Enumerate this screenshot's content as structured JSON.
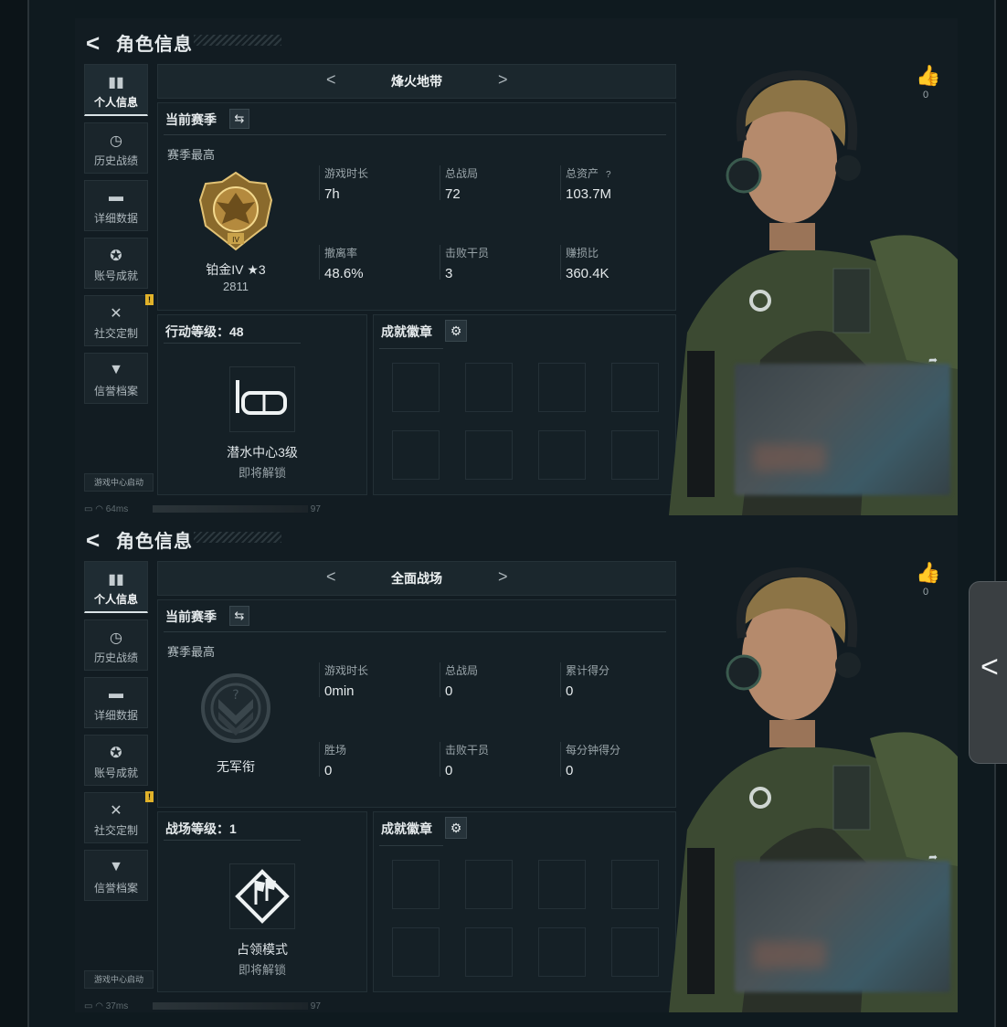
{
  "screens": [
    {
      "header": {
        "back": "<",
        "title": "角色信息"
      },
      "sidebar": [
        {
          "label": "个人信息",
          "icon": "bar-chart-icon",
          "glyph": "▮▮",
          "active": true
        },
        {
          "label": "历史战绩",
          "icon": "clock-icon",
          "glyph": "◷"
        },
        {
          "label": "详细数据",
          "icon": "folder-icon",
          "glyph": "▬"
        },
        {
          "label": "账号成就",
          "icon": "medal-icon",
          "glyph": "✪"
        },
        {
          "label": "社交定制",
          "icon": "tools-icon",
          "glyph": "✕",
          "warn": "!"
        },
        {
          "label": "信誉档案",
          "icon": "shield-icon",
          "glyph": "▼"
        }
      ],
      "game_center": "游戏中心启动",
      "status": {
        "ping": "64ms",
        "right": "97"
      },
      "mode": {
        "prev": "<",
        "name": "烽火地带",
        "next": ">"
      },
      "season": {
        "header": "当前赛季",
        "swap": "⇆",
        "best": "赛季最高",
        "rank_name": "铂金IV ★3",
        "rank_points": "2811",
        "stats": [
          {
            "k": "游戏时长",
            "v": "7h"
          },
          {
            "k": "总战局",
            "v": "72"
          },
          {
            "k": "总资产",
            "v": "103.7M",
            "q": "?"
          },
          {
            "k": "撤离率",
            "v": "48.6%"
          },
          {
            "k": "击败干员",
            "v": "3"
          },
          {
            "k": "赚损比",
            "v": "360.4K"
          }
        ]
      },
      "level": {
        "header": "行动等级：48",
        "unlock": "潜水中心3级",
        "soon": "即将解锁",
        "icon": "diving-mask-icon"
      },
      "badges": {
        "header": "成就徽章",
        "gear": "⚙"
      },
      "like": {
        "icon": "thumbs-up-icon",
        "count": "0"
      }
    },
    {
      "header": {
        "back": "<",
        "title": "角色信息"
      },
      "sidebar": [
        {
          "label": "个人信息",
          "icon": "bar-chart-icon",
          "glyph": "▮▮",
          "active": true
        },
        {
          "label": "历史战绩",
          "icon": "clock-icon",
          "glyph": "◷"
        },
        {
          "label": "详细数据",
          "icon": "folder-icon",
          "glyph": "▬"
        },
        {
          "label": "账号成就",
          "icon": "medal-icon",
          "glyph": "✪"
        },
        {
          "label": "社交定制",
          "icon": "tools-icon",
          "glyph": "✕",
          "warn": "!"
        },
        {
          "label": "信誉档案",
          "icon": "shield-icon",
          "glyph": "▼"
        }
      ],
      "game_center": "游戏中心启动",
      "status": {
        "ping": "37ms",
        "right": "97"
      },
      "mode": {
        "prev": "<",
        "name": "全面战场",
        "next": ">"
      },
      "season": {
        "header": "当前赛季",
        "swap": "⇆",
        "best": "赛季最高",
        "rank_name": "无军衔",
        "rank_points": "",
        "stats": [
          {
            "k": "游戏时长",
            "v": "0min"
          },
          {
            "k": "总战局",
            "v": "0"
          },
          {
            "k": "累计得分",
            "v": "0"
          },
          {
            "k": "胜场",
            "v": "0"
          },
          {
            "k": "击败干员",
            "v": "0"
          },
          {
            "k": "每分钟得分",
            "v": "0"
          }
        ]
      },
      "level": {
        "header": "战场等级：1",
        "unlock": "占领模式",
        "soon": "即将解锁",
        "icon": "flag-icon"
      },
      "badges": {
        "header": "成就徽章",
        "gear": "⚙"
      },
      "like": {
        "icon": "thumbs-up-icon",
        "count": "0"
      }
    }
  ],
  "side_tab": {
    "icon": "chevron-left-icon",
    "glyph": "<"
  },
  "colors": {
    "bg": "#121c22",
    "panel": "#152026",
    "accent_gold": "#c9a24a",
    "warn": "#e1b22a"
  }
}
